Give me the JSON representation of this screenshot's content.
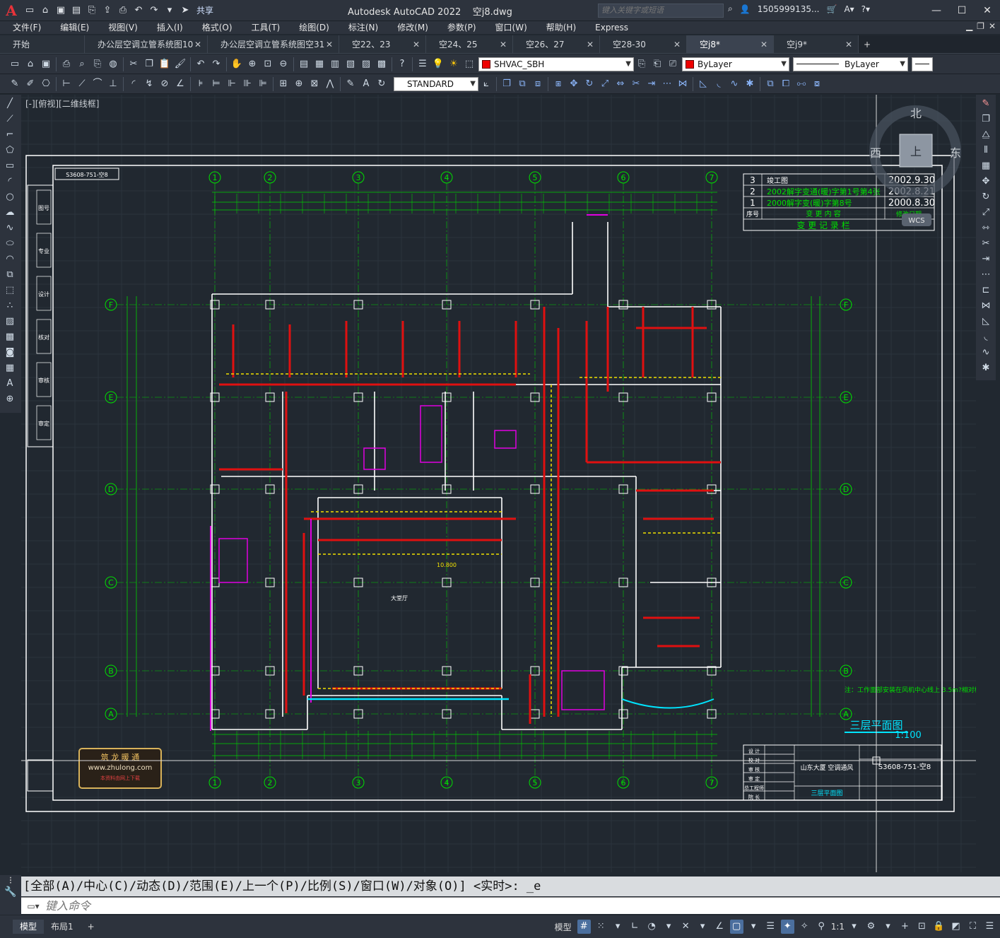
{
  "app": {
    "title": "Autodesk AutoCAD 2022",
    "file": "空j8.dwg",
    "share": "共享",
    "search_placeholder": "键入关键字或短语",
    "account": "1505999135...",
    "logo": "A"
  },
  "menu": [
    "文件(F)",
    "编辑(E)",
    "视图(V)",
    "插入(I)",
    "格式(O)",
    "工具(T)",
    "绘图(D)",
    "标注(N)",
    "修改(M)",
    "参数(P)",
    "窗口(W)",
    "帮助(H)",
    "Express"
  ],
  "tabs": [
    {
      "label": "开始",
      "active": false
    },
    {
      "label": "办公层空调立管系统图10",
      "active": false
    },
    {
      "label": "办公层空调立管系统图空31",
      "active": false
    },
    {
      "label": "空22、23",
      "active": false
    },
    {
      "label": "空24、25",
      "active": false
    },
    {
      "label": "空26、27",
      "active": false
    },
    {
      "label": "空28-30",
      "active": false
    },
    {
      "label": "空j8*",
      "active": true
    },
    {
      "label": "空j9*",
      "active": false
    }
  ],
  "toolbar": {
    "layer": "SHVAC_SBH",
    "color": "ByLayer",
    "linetype": "ByLayer",
    "textstyle": "STANDARD"
  },
  "viewport": {
    "label": "[-][俯视][二维线框]",
    "compass_n": "北",
    "compass_e": "东",
    "compass_w": "西",
    "compass_top": "上",
    "wcs": "WCS"
  },
  "drawing": {
    "columns": [
      "1",
      "2",
      "3",
      "4",
      "5",
      "6",
      "7"
    ],
    "rows": [
      "F",
      "E",
      "D",
      "C",
      "B",
      "A"
    ],
    "revisions": [
      {
        "no": "3",
        "desc": "竣工图",
        "date": "2002.9.30"
      },
      {
        "no": "2",
        "desc": "2002解字变通(暖)字第1号第4张",
        "date": "2002.8.21"
      },
      {
        "no": "1",
        "desc": "2000解字变(暖)字第8号",
        "date": "2000.8.30"
      }
    ],
    "rev_header_no": "序号",
    "rev_header_desc": "变 更 内 容",
    "rev_header_date": "修改日期",
    "rev_caption": "变 更 记 录 栏",
    "plan_title": "三层平面图",
    "scale": "1:100",
    "hall": "大堂厅",
    "project": "山东大厦 空调通风",
    "drawing_no": "S3608-751-空8",
    "sheet": "三层平面图",
    "stamp_top": "S3608-751-空8",
    "brand1": "筑 龙 暖 通",
    "brand2": "www.zhulong.com",
    "brand3": "本资料由网上下载",
    "note": "注：工作面部安装在风机中心线上 3.5m?相对标高系统底高?",
    "side_labels": [
      "图号",
      "专业",
      "设计",
      "核对",
      "审核",
      "审定"
    ],
    "tb_labels": [
      "设 计",
      "校 对",
      "审 核",
      "审 定",
      "总工程师",
      "院 长"
    ],
    "elevation": "10.800"
  },
  "command": {
    "history": "[全部(A)/中心(C)/动态(D)/范围(E)/上一个(P)/比例(S)/窗口(W)/对象(O)] <实时>: _e",
    "placeholder": "键入命令"
  },
  "status": {
    "model_tab": "模型",
    "layout_tab": "布局1",
    "model_btn": "模型",
    "scale": "1:1"
  }
}
